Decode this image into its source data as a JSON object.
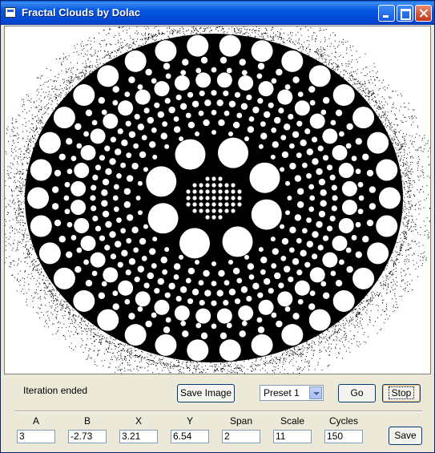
{
  "window": {
    "title": "Fractal Clouds by Dolac"
  },
  "titlebar_buttons": {
    "minimize": "minimize-icon",
    "maximize": "maximize-icon",
    "close": "close-icon"
  },
  "status": "Iteration ended",
  "buttons": {
    "save_image": "Save Image",
    "go": "Go",
    "stop": "Stop",
    "save": "Save"
  },
  "preset": {
    "selected": "Preset 1"
  },
  "params": [
    {
      "label": "A",
      "value": "3"
    },
    {
      "label": "B",
      "value": "-2.73"
    },
    {
      "label": "X",
      "value": "3.21"
    },
    {
      "label": "Y",
      "value": "6.54"
    },
    {
      "label": "Span",
      "value": "2"
    },
    {
      "label": "Scale",
      "value": "11"
    },
    {
      "label": "Cycles",
      "value": "150"
    }
  ],
  "colors": {
    "title_bar": "#0454e2",
    "window_face": "#ece9d8",
    "fractal_ink": "#000000",
    "fractal_background": "#ffffff"
  }
}
